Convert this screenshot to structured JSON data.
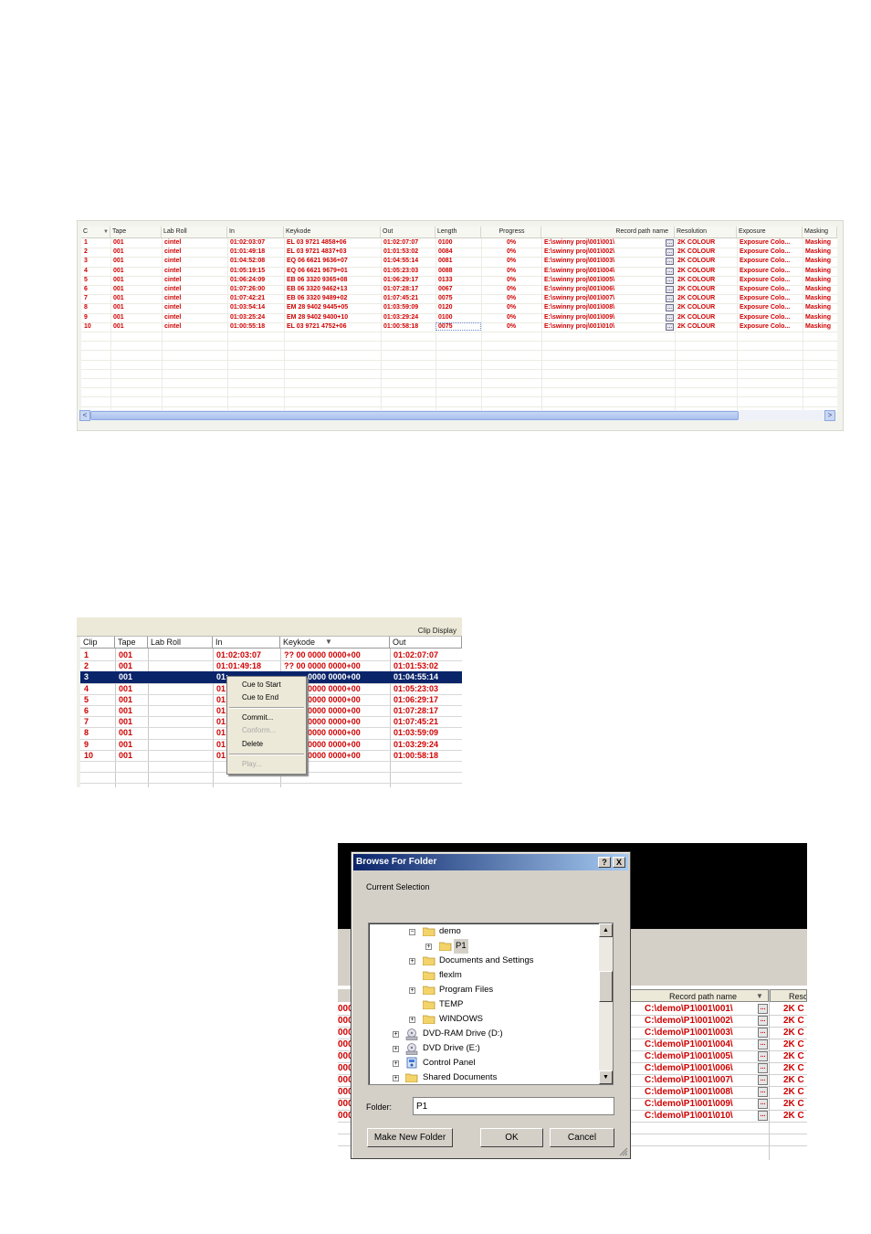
{
  "clip_grid": {
    "columns": [
      "C",
      "Tape",
      "Lab Roll",
      "In",
      "Keykode",
      "Out",
      "Length",
      "Progress",
      "Record path name",
      "Resolution",
      "Exposure",
      "Masking"
    ],
    "rows": [
      {
        "c": "1",
        "tape": "001",
        "lab_roll": "cintel",
        "in": "01:02:03:07",
        "keykode": "EL 03 9721 4858+06",
        "out": "01:02:07:07",
        "length": "0100",
        "progress": "0%",
        "record_path": "E:\\swinny proj\\001\\001\\",
        "resolution": "2K COLOUR",
        "exposure": "Exposure Colo...",
        "masking": "Masking"
      },
      {
        "c": "2",
        "tape": "001",
        "lab_roll": "cintel",
        "in": "01:01:49:18",
        "keykode": "EL 03 9721 4837+03",
        "out": "01:01:53:02",
        "length": "0084",
        "progress": "0%",
        "record_path": "E:\\swinny proj\\001\\002\\",
        "resolution": "2K COLOUR",
        "exposure": "Exposure Colo...",
        "masking": "Masking"
      },
      {
        "c": "3",
        "tape": "001",
        "lab_roll": "cintel",
        "in": "01:04:52:08",
        "keykode": "EQ 06 6621 9636+07",
        "out": "01:04:55:14",
        "length": "0081",
        "progress": "0%",
        "record_path": "E:\\swinny proj\\001\\003\\",
        "resolution": "2K COLOUR",
        "exposure": "Exposure Colo...",
        "masking": "Masking"
      },
      {
        "c": "4",
        "tape": "001",
        "lab_roll": "cintel",
        "in": "01:05:19:15",
        "keykode": "EQ 06 6621 9679+01",
        "out": "01:05:23:03",
        "length": "0088",
        "progress": "0%",
        "record_path": "E:\\swinny proj\\001\\004\\",
        "resolution": "2K COLOUR",
        "exposure": "Exposure Colo...",
        "masking": "Masking"
      },
      {
        "c": "5",
        "tape": "001",
        "lab_roll": "cintel",
        "in": "01:06:24:09",
        "keykode": "EB 06 3320 9365+08",
        "out": "01:06:29:17",
        "length": "0133",
        "progress": "0%",
        "record_path": "E:\\swinny proj\\001\\005\\",
        "resolution": "2K COLOUR",
        "exposure": "Exposure Colo...",
        "masking": "Masking"
      },
      {
        "c": "6",
        "tape": "001",
        "lab_roll": "cintel",
        "in": "01:07:26:00",
        "keykode": "EB 06 3320 9462+13",
        "out": "01:07:28:17",
        "length": "0067",
        "progress": "0%",
        "record_path": "E:\\swinny proj\\001\\006\\",
        "resolution": "2K COLOUR",
        "exposure": "Exposure Colo...",
        "masking": "Masking"
      },
      {
        "c": "7",
        "tape": "001",
        "lab_roll": "cintel",
        "in": "01:07:42:21",
        "keykode": "EB 06 3320 9489+02",
        "out": "01:07:45:21",
        "length": "0075",
        "progress": "0%",
        "record_path": "E:\\swinny proj\\001\\007\\",
        "resolution": "2K COLOUR",
        "exposure": "Exposure Colo...",
        "masking": "Masking"
      },
      {
        "c": "8",
        "tape": "001",
        "lab_roll": "cintel",
        "in": "01:03:54:14",
        "keykode": "EM 28 9402 9445+05",
        "out": "01:03:59:09",
        "length": "0120",
        "progress": "0%",
        "record_path": "E:\\swinny proj\\001\\008\\",
        "resolution": "2K COLOUR",
        "exposure": "Exposure Colo...",
        "masking": "Masking"
      },
      {
        "c": "9",
        "tape": "001",
        "lab_roll": "cintel",
        "in": "01:03:25:24",
        "keykode": "EM 28 9402 9400+10",
        "out": "01:03:29:24",
        "length": "0100",
        "progress": "0%",
        "record_path": "E:\\swinny proj\\001\\009\\",
        "resolution": "2K COLOUR",
        "exposure": "Exposure Colo...",
        "masking": "Masking"
      },
      {
        "c": "10",
        "tape": "001",
        "lab_roll": "cintel",
        "in": "01:00:55:18",
        "keykode": "EL 03 9721 4752+06",
        "out": "01:00:58:18",
        "length": "0075",
        "progress": "0%",
        "record_path": "E:\\swinny proj\\001\\010\\",
        "resolution": "2K COLOUR",
        "exposure": "Exposure Colo...",
        "masking": "Masking"
      }
    ],
    "browse_button": "...",
    "scroll_left": "<",
    "scroll_right": ">"
  },
  "clip_display": {
    "caption": "Clip Display",
    "columns": [
      "Clip",
      "Tape",
      "Lab Roll",
      "In",
      "Keykode",
      "Out"
    ],
    "rows": [
      {
        "clip": "1",
        "tape": "001",
        "in": "01:02:03:07",
        "keykode": "?? 00 0000 0000+00",
        "out": "01:02:07:07"
      },
      {
        "clip": "2",
        "tape": "001",
        "in": "01:01:49:18",
        "keykode": "?? 00 0000 0000+00",
        "out": "01:01:53:02"
      },
      {
        "clip": "3",
        "tape": "001",
        "in": "01:",
        "keykode": "0000 0000+00",
        "out": "01:04:55:14"
      },
      {
        "clip": "4",
        "tape": "001",
        "in": "01:",
        "keykode": "0000 0000+00",
        "out": "01:05:23:03"
      },
      {
        "clip": "5",
        "tape": "001",
        "in": "01:",
        "keykode": "0000 0000+00",
        "out": "01:06:29:17"
      },
      {
        "clip": "6",
        "tape": "001",
        "in": "01:",
        "keykode": "0000 0000+00",
        "out": "01:07:28:17"
      },
      {
        "clip": "7",
        "tape": "001",
        "in": "01:",
        "keykode": "0000 0000+00",
        "out": "01:07:45:21"
      },
      {
        "clip": "8",
        "tape": "001",
        "in": "01:",
        "keykode": "0000 0000+00",
        "out": "01:03:59:09"
      },
      {
        "clip": "9",
        "tape": "001",
        "in": "01:",
        "keykode": "0000 0000+00",
        "out": "01:03:29:24"
      },
      {
        "clip": "10",
        "tape": "001",
        "in": "01:",
        "keykode": "0000 0000+00",
        "out": "01:00:58:18"
      }
    ],
    "selected_row": 2,
    "context_menu": {
      "cue_to_start": "Cue to Start",
      "cue_to_end": "Cue to End",
      "commit": "Commit...",
      "conform": "Conform...",
      "delete": "Delete",
      "play": "Play..."
    }
  },
  "browse_dialog": {
    "title": "Browse For Folder",
    "help_button": "?",
    "close_button": "X",
    "current_selection_label": "Current Selection",
    "tree": {
      "demo": "demo",
      "p1": "P1",
      "documents_and_settings": "Documents and Settings",
      "flexlm": "flexlm",
      "program_files": "Program Files",
      "temp": "TEMP",
      "windows": "WINDOWS",
      "dvd_ram": "DVD-RAM Drive (D:)",
      "dvd": "DVD Drive (E:)",
      "control_panel": "Control Panel",
      "shared_documents": "Shared Documents"
    },
    "folder_label": "Folder:",
    "folder_value": "P1",
    "make_new_folder": "Make New Folder",
    "ok": "OK",
    "cancel": "Cancel",
    "background_grid": {
      "record_path_header": "Record path name",
      "resolution_header": "Reso",
      "paths": [
        "C:\\demo\\P1\\001\\001\\",
        "C:\\demo\\P1\\001\\002\\",
        "C:\\demo\\P1\\001\\003\\",
        "C:\\demo\\P1\\001\\004\\",
        "C:\\demo\\P1\\001\\005\\",
        "C:\\demo\\P1\\001\\006\\",
        "C:\\demo\\P1\\001\\007\\",
        "C:\\demo\\P1\\001\\008\\",
        "C:\\demo\\P1\\001\\009\\",
        "C:\\demo\\P1\\001\\010\\"
      ],
      "left_values": [
        "000",
        "000",
        "000",
        "000",
        "000",
        "000",
        "000",
        "000",
        "000",
        "000"
      ],
      "resolution_values": [
        "2K C",
        "2K C",
        "2K C",
        "2K C",
        "2K C",
        "2K C",
        "2K C",
        "2K C",
        "2K C",
        "2K C"
      ]
    }
  }
}
